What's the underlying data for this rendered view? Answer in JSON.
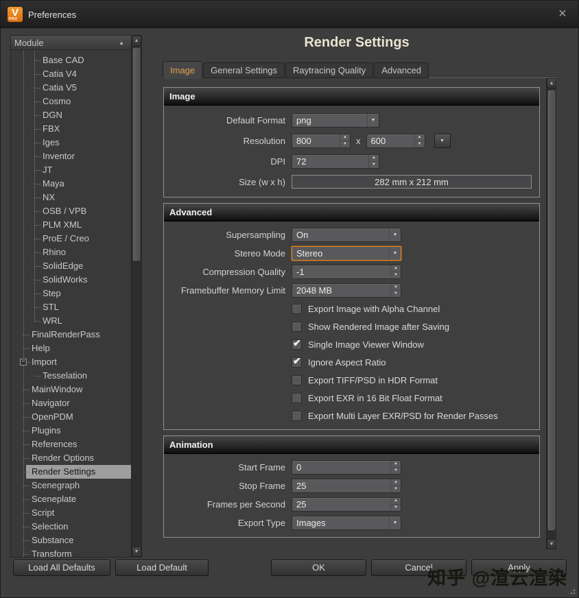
{
  "window": {
    "title": "Preferences",
    "logo_text": "V",
    "logo_sub": "PRO"
  },
  "icons": {
    "close": "✕",
    "sort_asc": "▲",
    "dropdown_arrow": "▼",
    "spin_up": "▲",
    "spin_down": "▼",
    "check": "✔",
    "expander_minus": "−",
    "scroll_up": "▲",
    "scroll_down": "▼"
  },
  "sidebar": {
    "header": "Module",
    "items": [
      {
        "label": "Base CAD",
        "indent": 2
      },
      {
        "label": "Catia V4",
        "indent": 2
      },
      {
        "label": "Catia V5",
        "indent": 2
      },
      {
        "label": "Cosmo",
        "indent": 2
      },
      {
        "label": "DGN",
        "indent": 2
      },
      {
        "label": "FBX",
        "indent": 2
      },
      {
        "label": "Iges",
        "indent": 2
      },
      {
        "label": "Inventor",
        "indent": 2
      },
      {
        "label": "JT",
        "indent": 2
      },
      {
        "label": "Maya",
        "indent": 2
      },
      {
        "label": "NX",
        "indent": 2
      },
      {
        "label": "OSB / VPB",
        "indent": 2
      },
      {
        "label": "PLM XML",
        "indent": 2
      },
      {
        "label": "ProE / Creo",
        "indent": 2
      },
      {
        "label": "Rhino",
        "indent": 2
      },
      {
        "label": "SolidEdge",
        "indent": 2
      },
      {
        "label": "SolidWorks",
        "indent": 2
      },
      {
        "label": "Step",
        "indent": 2
      },
      {
        "label": "STL",
        "indent": 2
      },
      {
        "label": "WRL",
        "indent": 2
      },
      {
        "label": "FinalRenderPass",
        "indent": 1
      },
      {
        "label": "Help",
        "indent": 1
      },
      {
        "label": "Import",
        "indent": 1,
        "has_expander": true
      },
      {
        "label": "Tesselation",
        "indent": 2
      },
      {
        "label": "MainWindow",
        "indent": 1
      },
      {
        "label": "Navigator",
        "indent": 1
      },
      {
        "label": "OpenPDM",
        "indent": 1
      },
      {
        "label": "Plugins",
        "indent": 1
      },
      {
        "label": "References",
        "indent": 1
      },
      {
        "label": "Render Options",
        "indent": 1
      },
      {
        "label": "Render Settings",
        "indent": 1,
        "selected": true
      },
      {
        "label": "Scenegraph",
        "indent": 1
      },
      {
        "label": "Sceneplate",
        "indent": 1
      },
      {
        "label": "Script",
        "indent": 1
      },
      {
        "label": "Selection",
        "indent": 1
      },
      {
        "label": "Substance",
        "indent": 1
      },
      {
        "label": "Transform",
        "indent": 1
      }
    ]
  },
  "content": {
    "title": "Render Settings",
    "tabs": [
      {
        "label": "Image",
        "active": true
      },
      {
        "label": "General Settings"
      },
      {
        "label": "Raytracing Quality"
      },
      {
        "label": "Advanced"
      }
    ],
    "image_group": {
      "title": "Image",
      "default_format": {
        "label": "Default Format",
        "value": "png"
      },
      "resolution": {
        "label": "Resolution",
        "width": "800",
        "sep": "x",
        "height": "600"
      },
      "dpi": {
        "label": "DPI",
        "value": "72"
      },
      "size": {
        "label": "Size (w x h)",
        "value": "282 mm x 212 mm"
      }
    },
    "advanced_group": {
      "title": "Advanced",
      "supersampling": {
        "label": "Supersampling",
        "value": "On"
      },
      "stereo_mode": {
        "label": "Stereo Mode",
        "value": "Stereo"
      },
      "compression_quality": {
        "label": "Compression Quality",
        "value": "-1"
      },
      "framebuffer_memory": {
        "label": "Framebuffer Memory Limit",
        "value": "2048 MB"
      },
      "checkboxes": [
        {
          "label": "Export Image with Alpha Channel"
        },
        {
          "label": "Show Rendered Image after Saving"
        },
        {
          "label": "Single Image Viewer Window",
          "checked": true
        },
        {
          "label": "Ignore Aspect Ratio",
          "checked": true
        },
        {
          "label": "Export TIFF/PSD in HDR Format"
        },
        {
          "label": "Export EXR in 16 Bit Float Format"
        },
        {
          "label": "Export Multi Layer EXR/PSD for Render Passes"
        }
      ]
    },
    "animation_group": {
      "title": "Animation",
      "start_frame": {
        "label": "Start Frame",
        "value": "0"
      },
      "stop_frame": {
        "label": "Stop Frame",
        "value": "25"
      },
      "fps": {
        "label": "Frames per Second",
        "value": "25"
      },
      "export_type": {
        "label": "Export Type",
        "value": "Images"
      }
    }
  },
  "footer": {
    "load_all_defaults": "Load All Defaults",
    "load_default": "Load Default",
    "ok": "OK",
    "cancel": "Cancel",
    "apply": "Apply"
  },
  "watermark": "知乎 @渲云渲染",
  "colors": {
    "accent_orange": "#e8820e",
    "focus_border": "#f08a1a",
    "selection_bg": "#9e9e9e"
  }
}
